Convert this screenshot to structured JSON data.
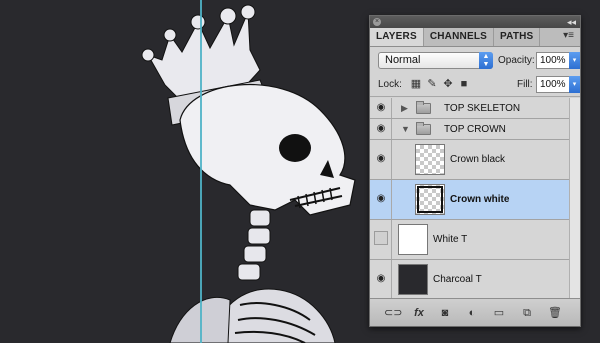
{
  "panel": {
    "tabs": [
      "LAYERS",
      "CHANNELS",
      "PATHS"
    ],
    "blend_mode": "Normal",
    "opacity_label": "Opacity:",
    "opacity_value": "100%",
    "lock_label": "Lock:",
    "fill_label": "Fill:",
    "fill_value": "100%",
    "layers": [
      {
        "name": "TOP SKELETON",
        "type": "group",
        "expanded": false,
        "visible": true
      },
      {
        "name": "TOP CROWN",
        "type": "group",
        "expanded": true,
        "visible": true
      },
      {
        "name": "Crown black",
        "type": "layer",
        "visible": true,
        "thumbnail": "transparent"
      },
      {
        "name": "Crown white",
        "type": "layer",
        "visible": true,
        "selected": true,
        "thumbnail": "transparent"
      },
      {
        "name": "White T",
        "type": "layer",
        "visible": false,
        "thumbnail": "white"
      },
      {
        "name": "Charcoal T",
        "type": "layer",
        "visible": true,
        "thumbnail": "charcoal"
      }
    ]
  },
  "colors": {
    "canvas_background": "#29292d",
    "guide": "#4fb3c6",
    "selection": "#b7d3f4",
    "accent": "#2d6fd2"
  }
}
